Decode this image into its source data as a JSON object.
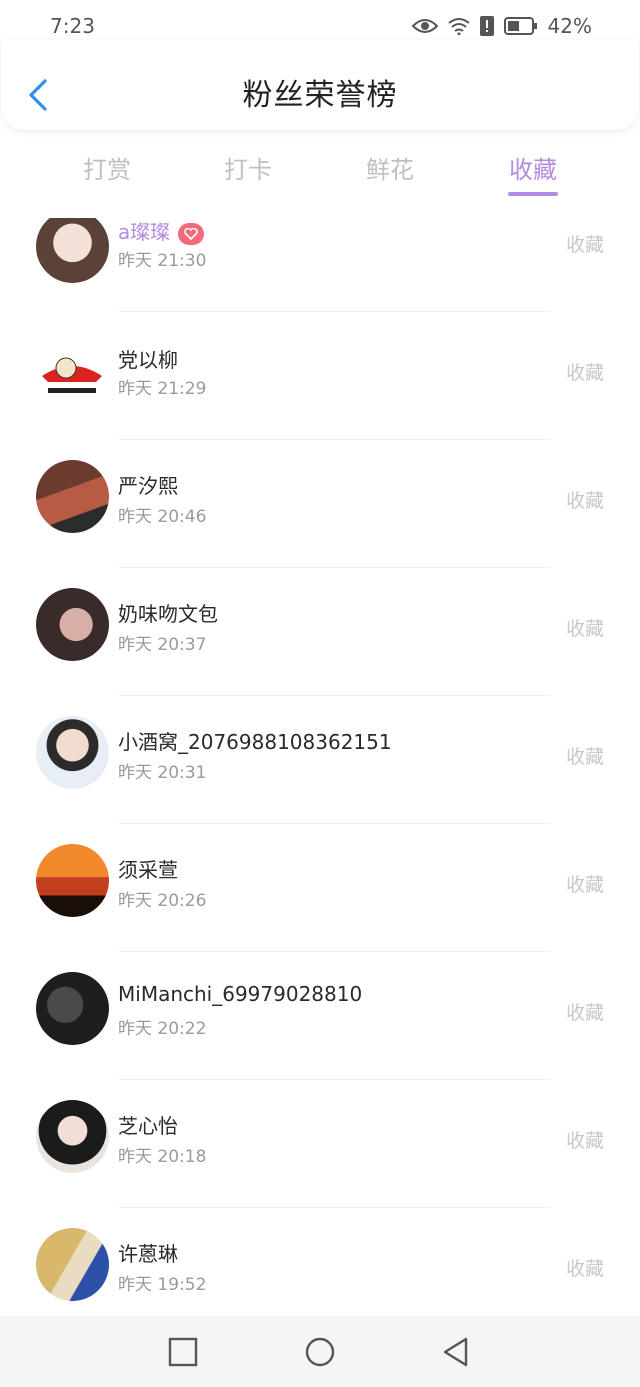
{
  "status_bar": {
    "time": "7:23",
    "battery": "42%"
  },
  "header": {
    "title": "粉丝荣誉榜"
  },
  "tabs": [
    {
      "label": "打赏"
    },
    {
      "label": "打卡"
    },
    {
      "label": "鲜花"
    },
    {
      "label": "收藏"
    }
  ],
  "active_tab": 3,
  "accent_color": "#b48be0",
  "rows": [
    {
      "name": "a璨璨",
      "time": "昨天 21:30",
      "action": "收藏",
      "badge": "heart-icon"
    },
    {
      "name": "党以柳",
      "time": "昨天 21:29",
      "action": "收藏"
    },
    {
      "name": "严汐熙",
      "time": "昨天 20:46",
      "action": "收藏"
    },
    {
      "name": "奶味吻文包",
      "time": "昨天 20:37",
      "action": "收藏"
    },
    {
      "name": "小酒窝_2076988108362151",
      "time": "昨天 20:31",
      "action": "收藏"
    },
    {
      "name": "须采萱",
      "time": "昨天 20:26",
      "action": "收藏"
    },
    {
      "name": "MiManchi_69979028810",
      "time": "昨天 20:22",
      "action": "收藏"
    },
    {
      "name": "芝心怡",
      "time": "昨天 20:18",
      "action": "收藏"
    },
    {
      "name": "许蒽琳",
      "time": "昨天 19:52",
      "action": "收藏"
    }
  ]
}
